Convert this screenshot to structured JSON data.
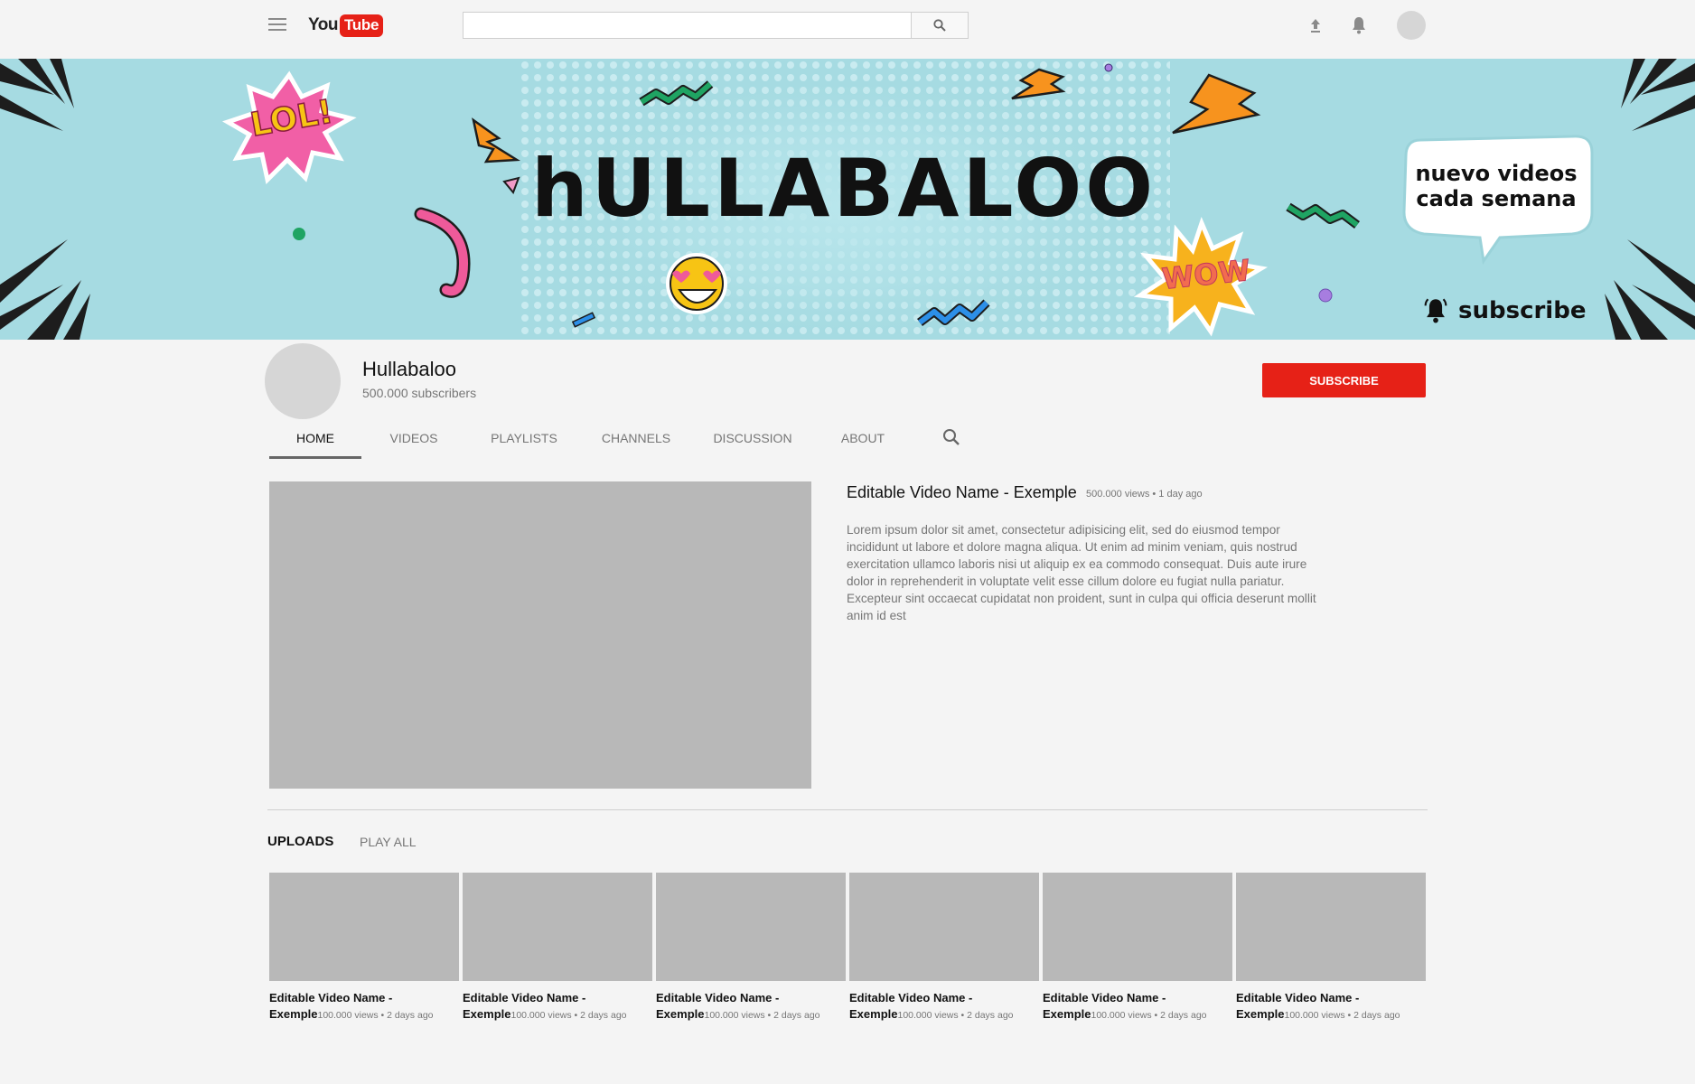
{
  "header": {
    "logo_you": "You",
    "logo_tube": "Tube",
    "search_placeholder": "",
    "icons": [
      "menu-icon",
      "search-icon",
      "upload-icon",
      "bell-icon",
      "avatar"
    ]
  },
  "banner": {
    "title": "hULLABALOO",
    "bubble_line1": "nuevo videos",
    "bubble_line2": "cada semana",
    "sticker_lol": "LOL!",
    "sticker_wow": "WOW",
    "subscribe_text": "subscribe"
  },
  "channel": {
    "name": "Hullabaloo",
    "subscribers": "500.000 subscribers",
    "subscribe_label": "SUBSCRIBE"
  },
  "tabs": [
    {
      "label": "HOME",
      "active": true
    },
    {
      "label": "VIDEOS"
    },
    {
      "label": "PLAYLISTS"
    },
    {
      "label": "CHANNELS"
    },
    {
      "label": "DISCUSSION"
    },
    {
      "label": "ABOUT"
    }
  ],
  "featured": {
    "title": "Editable Video Name - Exemple",
    "meta": "500.000 views • 1 day ago",
    "description": "Lorem ipsum dolor sit amet, consectetur adipisicing elit, sed do eiusmod tempor incididunt ut labore et dolore magna aliqua. Ut enim ad minim veniam, quis nostrud exercitation ullamco laboris nisi ut aliquip ex ea commodo consequat. Duis aute irure dolor in reprehenderit in voluptate velit esse cillum dolore eu fugiat nulla pariatur. Excepteur sint occaecat cupidatat non proident, sunt in culpa qui officia deserunt mollit anim id est"
  },
  "uploads": {
    "label": "UPLOADS",
    "play_all": "PLAY ALL",
    "items": [
      {
        "title": "Editable Video Name - Exemple",
        "meta": "100.000 views • 2 days ago"
      },
      {
        "title": "Editable Video Name - Exemple",
        "meta": "100.000 views • 2 days ago"
      },
      {
        "title": "Editable Video Name - Exemple",
        "meta": "100.000 views • 2 days ago"
      },
      {
        "title": "Editable Video Name - Exemple",
        "meta": "100.000 views • 2 days ago"
      },
      {
        "title": "Editable Video Name - Exemple",
        "meta": "100.000 views • 2 days ago"
      },
      {
        "title": "Editable Video Name - Exemple",
        "meta": "100.000 views • 2 days ago"
      }
    ]
  },
  "colors": {
    "brand_red": "#e62117",
    "banner_bg": "#a6dbe2",
    "page_bg": "#f4f4f4",
    "placeholder_gray": "#b8b8b8"
  }
}
